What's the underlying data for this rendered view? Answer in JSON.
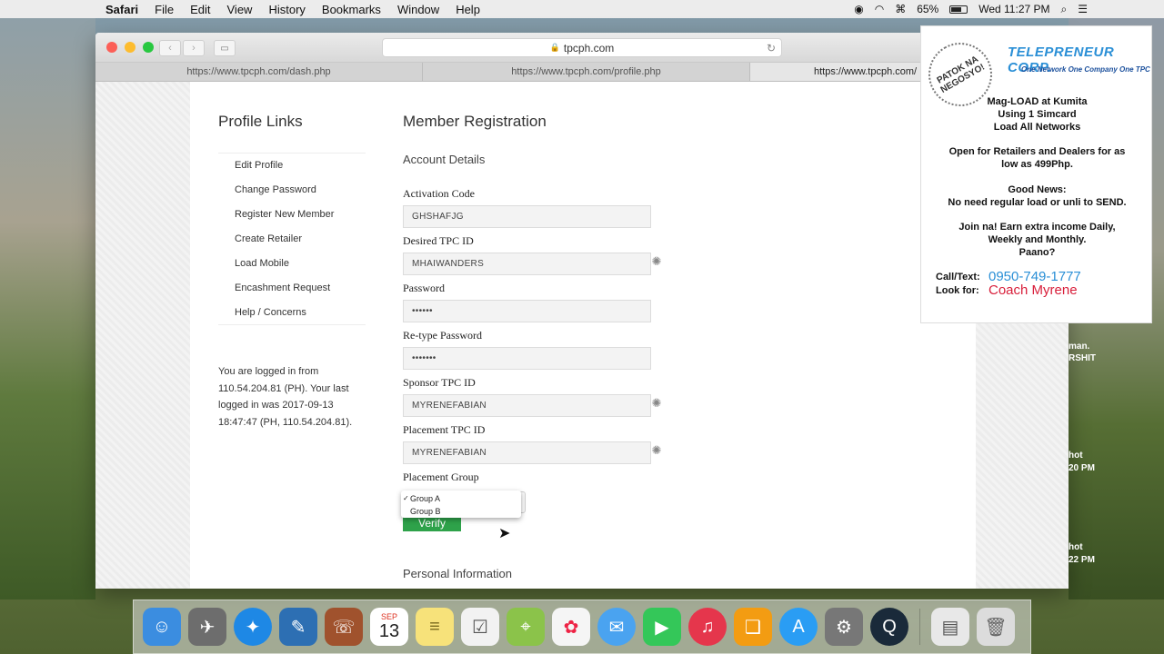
{
  "menubar": {
    "app": "Safari",
    "items": [
      "File",
      "Edit",
      "View",
      "History",
      "Bookmarks",
      "Window",
      "Help"
    ],
    "battery": "65%",
    "clock": "Wed 11:27 PM"
  },
  "browser": {
    "address": "tpcph.com",
    "tabs": [
      "https://www.tpcph.com/dash.php",
      "https://www.tpcph.com/profile.php",
      "https://www.tpcph.com/"
    ]
  },
  "sidebar": {
    "title": "Profile Links",
    "links": [
      "Edit Profile",
      "Change Password",
      "Register New Member",
      "Create Retailer",
      "Load Mobile",
      "Encashment Request",
      "Help / Concerns"
    ],
    "login_info": "You are logged in from 110.54.204.81 (PH). Your last logged in was 2017-09-13 18:47:47 (PH, 110.54.204.81)."
  },
  "form": {
    "title": "Member Registration",
    "account_section": "Account Details",
    "activation_code_label": "Activation Code",
    "activation_code_value": "GHSHAFJG",
    "tpc_id_label": "Desired TPC ID",
    "tpc_id_value": "MHAIWANDERS",
    "password_label": "Password",
    "password_value": "••••••",
    "retype_label": "Re-type Password",
    "retype_value": "•••••••",
    "sponsor_label": "Sponsor TPC ID",
    "sponsor_value": "MYRENEFABIAN",
    "placement_label": "Placement TPC ID",
    "placement_value": "MYRENEFABIAN",
    "group_label": "Placement Group",
    "group_options": [
      "Group A",
      "Group B"
    ],
    "verify_label": "Verify",
    "personal_section": "Personal Information"
  },
  "ad": {
    "badge": "PATOK NA NEGOSYO!",
    "logo": "TELEPRENEUR CORP.",
    "tagline": "One Network One Company One TPC",
    "line1": "Mag-LOAD at Kumita",
    "line2": "Using 1 Simcard",
    "line3": "Load All Networks",
    "line4": "Open for Retailers and Dealers for as",
    "line5": "low as 499Php.",
    "line6": "Good News:",
    "line7": "No need regular load or unli to SEND.",
    "line8": "Join na! Earn extra income Daily,",
    "line9": "Weekly and Monthly.",
    "line10": "Paano?",
    "call_label": "Call/Text:",
    "look_label": "Look for:",
    "phone": "0950-749-1777",
    "coach": "Coach Myrene"
  },
  "desktop": {
    "label1a": "man.",
    "label1b": "RSHIT",
    "label2a": "hot",
    "label2b": "20 PM",
    "label3a": "hot",
    "label3b": "22 PM"
  },
  "dock": {
    "calendar_month": "SEP",
    "calendar_day": "13"
  },
  "colors": {
    "verify_green": "#2ea24a",
    "ad_blue": "#2a8fd6",
    "ad_red": "#d81e3a"
  }
}
